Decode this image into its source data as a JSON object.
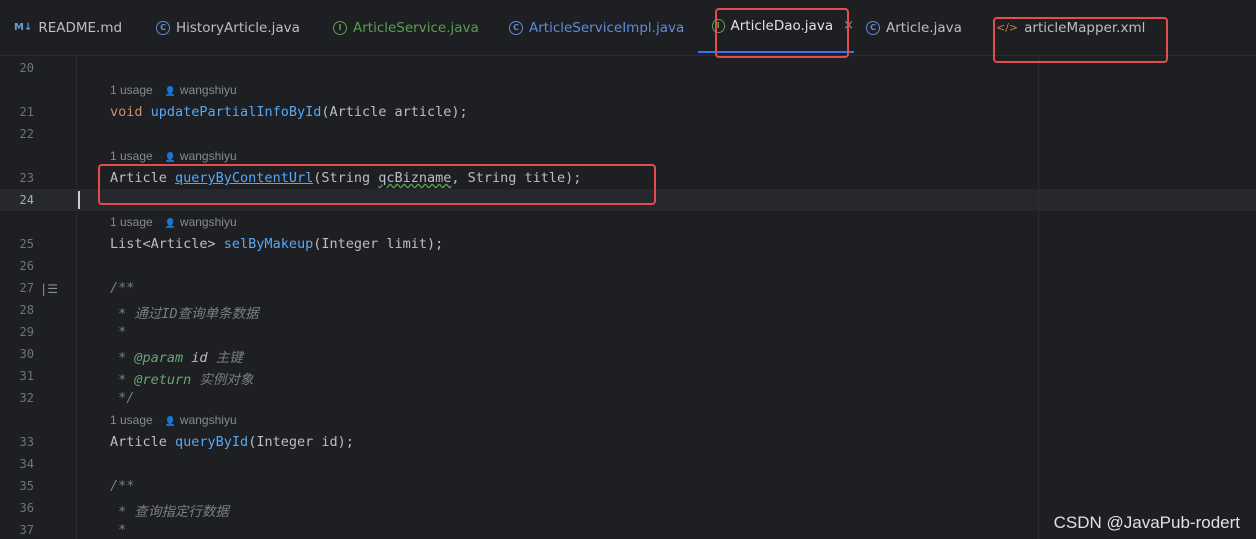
{
  "tabs": [
    {
      "label": "README.md",
      "icon": "markdown-icon",
      "icon_text": "M↓"
    },
    {
      "label": "HistoryArticle.java",
      "icon": "class-icon",
      "icon_text": "C"
    },
    {
      "label": "ArticleService.java",
      "icon": "interface-icon",
      "icon_text": "I"
    },
    {
      "label": "ArticleServiceImpl.java",
      "icon": "class-icon",
      "icon_text": "C"
    },
    {
      "label": "ArticleDao.java",
      "icon": "interface-icon",
      "icon_text": "I",
      "active": true,
      "close": "×"
    },
    {
      "label": "Article.java",
      "icon": "class-icon",
      "icon_text": "C"
    },
    {
      "label": "articleMapper.xml",
      "icon": "xml-icon",
      "icon_text": "</>"
    }
  ],
  "line_numbers": [
    "20",
    "21",
    "22",
    "23",
    "24",
    "25",
    "26",
    "27",
    "28",
    "29",
    "30",
    "31",
    "32",
    "33",
    "34",
    "35",
    "36",
    "37"
  ],
  "hints": {
    "usage": "1 usage",
    "author": "wangshiyu"
  },
  "code": {
    "l21": {
      "kw": "void",
      "fn": "updatePartialInfoById",
      "rest": "(Article article);"
    },
    "l23": {
      "type": "Article ",
      "fn": "queryByContentUrl",
      "p1": "(String ",
      "squig": "qcBizname",
      "rest": ", String title);"
    },
    "l25": {
      "type": "List<Article> ",
      "fn": "selByMakeup",
      "rest": "(Integer limit);"
    },
    "l27": "/**",
    "l28": " * 通过ID查询单条数据",
    "l29": " *",
    "l30": {
      "pre": " * ",
      "tag": "@param",
      "name": " id",
      "desc": " 主键"
    },
    "l31": {
      "pre": " * ",
      "tag": "@return",
      "desc": " 实例对象"
    },
    "l32": " */",
    "l33": {
      "type": "Article ",
      "fn": "queryById",
      "rest": "(Integer id);"
    },
    "l35": "/**",
    "l36": " * 查询指定行数据",
    "l37": " *"
  },
  "watermark": "CSDN @JavaPub-rodert"
}
